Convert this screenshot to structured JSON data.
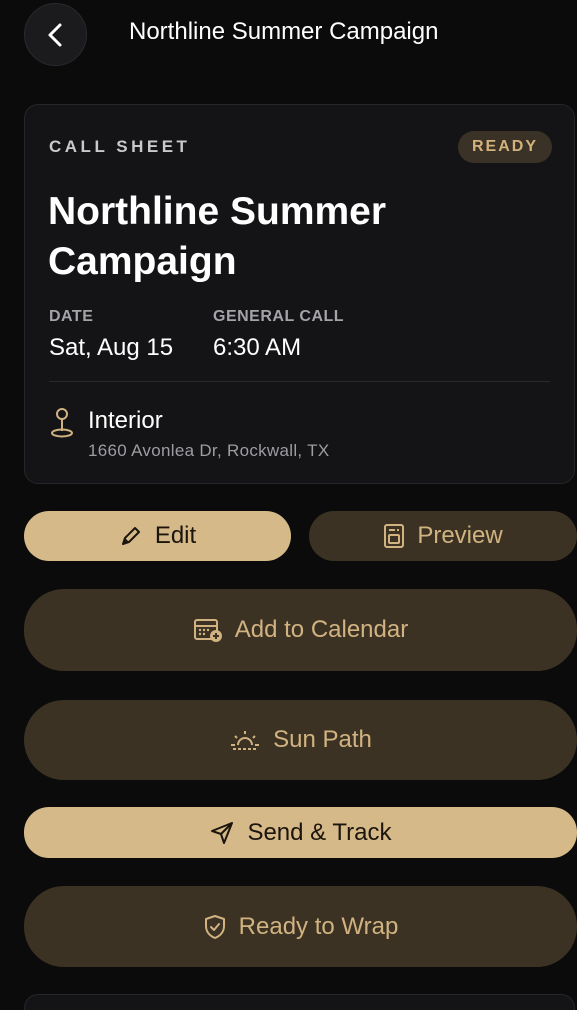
{
  "header": {
    "title": "Northline Summer Campaign"
  },
  "card": {
    "eyebrow": "CALL SHEET",
    "status": "READY",
    "title": "Northline Summer Campaign",
    "date_label": "DATE",
    "date_value": "Sat, Aug 15",
    "call_label": "GENERAL CALL",
    "call_value": "6:30 AM",
    "location_name": "Interior",
    "location_address": "1660 Avonlea Dr, Rockwall, TX"
  },
  "actions": {
    "edit": "Edit",
    "preview": "Preview",
    "add_calendar": "Add to Calendar",
    "sun_path": "Sun Path",
    "send_track": "Send & Track",
    "ready_wrap": "Ready to Wrap"
  },
  "colors": {
    "background": "#0b0b0c",
    "card": "#141416",
    "accent_light": "#d6b988",
    "accent_dark": "#3c3223",
    "accent_text": "#d1b381"
  },
  "icons": {
    "back": "chevron-left-icon",
    "location": "location-pin-icon",
    "edit": "pencil-icon",
    "preview": "document-preview-icon",
    "calendar": "calendar-add-icon",
    "sun": "sunrise-icon",
    "send": "paper-plane-icon",
    "wrap": "shield-check-icon"
  }
}
